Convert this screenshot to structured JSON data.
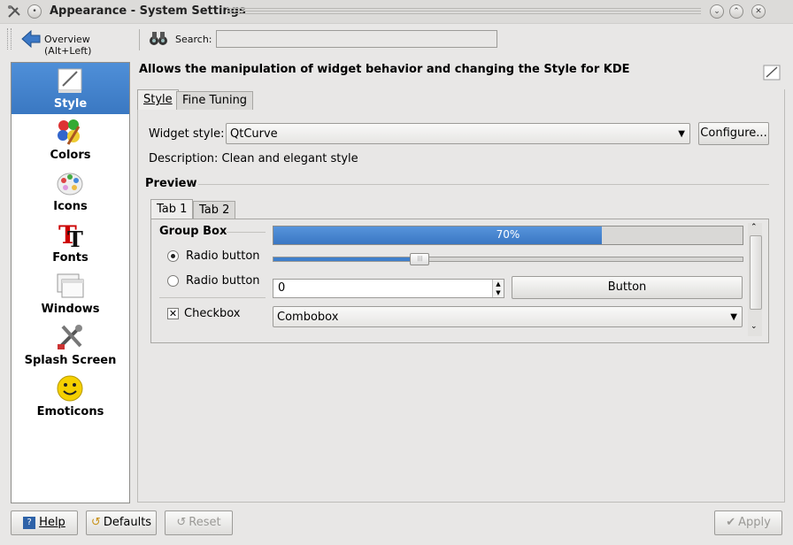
{
  "window": {
    "title": "Appearance - System Settings"
  },
  "toolbar": {
    "overview_label": "Overview (Alt+Left)",
    "search_label": "Search:",
    "search_value": ""
  },
  "sidebar": {
    "items": [
      {
        "label": "Style",
        "icon": "style-icon",
        "selected": true
      },
      {
        "label": "Colors",
        "icon": "colors-icon"
      },
      {
        "label": "Icons",
        "icon": "icons-icon"
      },
      {
        "label": "Fonts",
        "icon": "fonts-icon"
      },
      {
        "label": "Windows",
        "icon": "windows-icon"
      },
      {
        "label": "Splash Screen",
        "icon": "splash-screen-icon"
      },
      {
        "label": "Emoticons",
        "icon": "emoticons-icon"
      }
    ]
  },
  "main": {
    "header": "Allows the manipulation of widget behavior and changing the Style for KDE",
    "tabs": [
      "Style",
      "Fine Tuning"
    ],
    "widget_style_label": "Widget style:",
    "widget_style_value": "QtCurve",
    "configure_label": "Configure...",
    "description": "Description: Clean and elegant style",
    "preview_label": "Preview",
    "preview": {
      "tabs": [
        "Tab 1",
        "Tab 2"
      ],
      "group_box_label": "Group Box",
      "progress_value": 0.7,
      "progress_label": "70%",
      "slider_value": 0.31,
      "radio1_label": "Radio button",
      "radio2_label": "Radio button",
      "spin_value": "0",
      "button_label": "Button",
      "checkbox_label": "Checkbox",
      "combobox_label": "Combobox"
    }
  },
  "bottom": {
    "help_label": "Help",
    "defaults_label": "Defaults",
    "reset_label": "Reset",
    "apply_label": "Apply"
  },
  "colors": {
    "selection": "#3f7fcb",
    "background": "#e8e7e6"
  }
}
